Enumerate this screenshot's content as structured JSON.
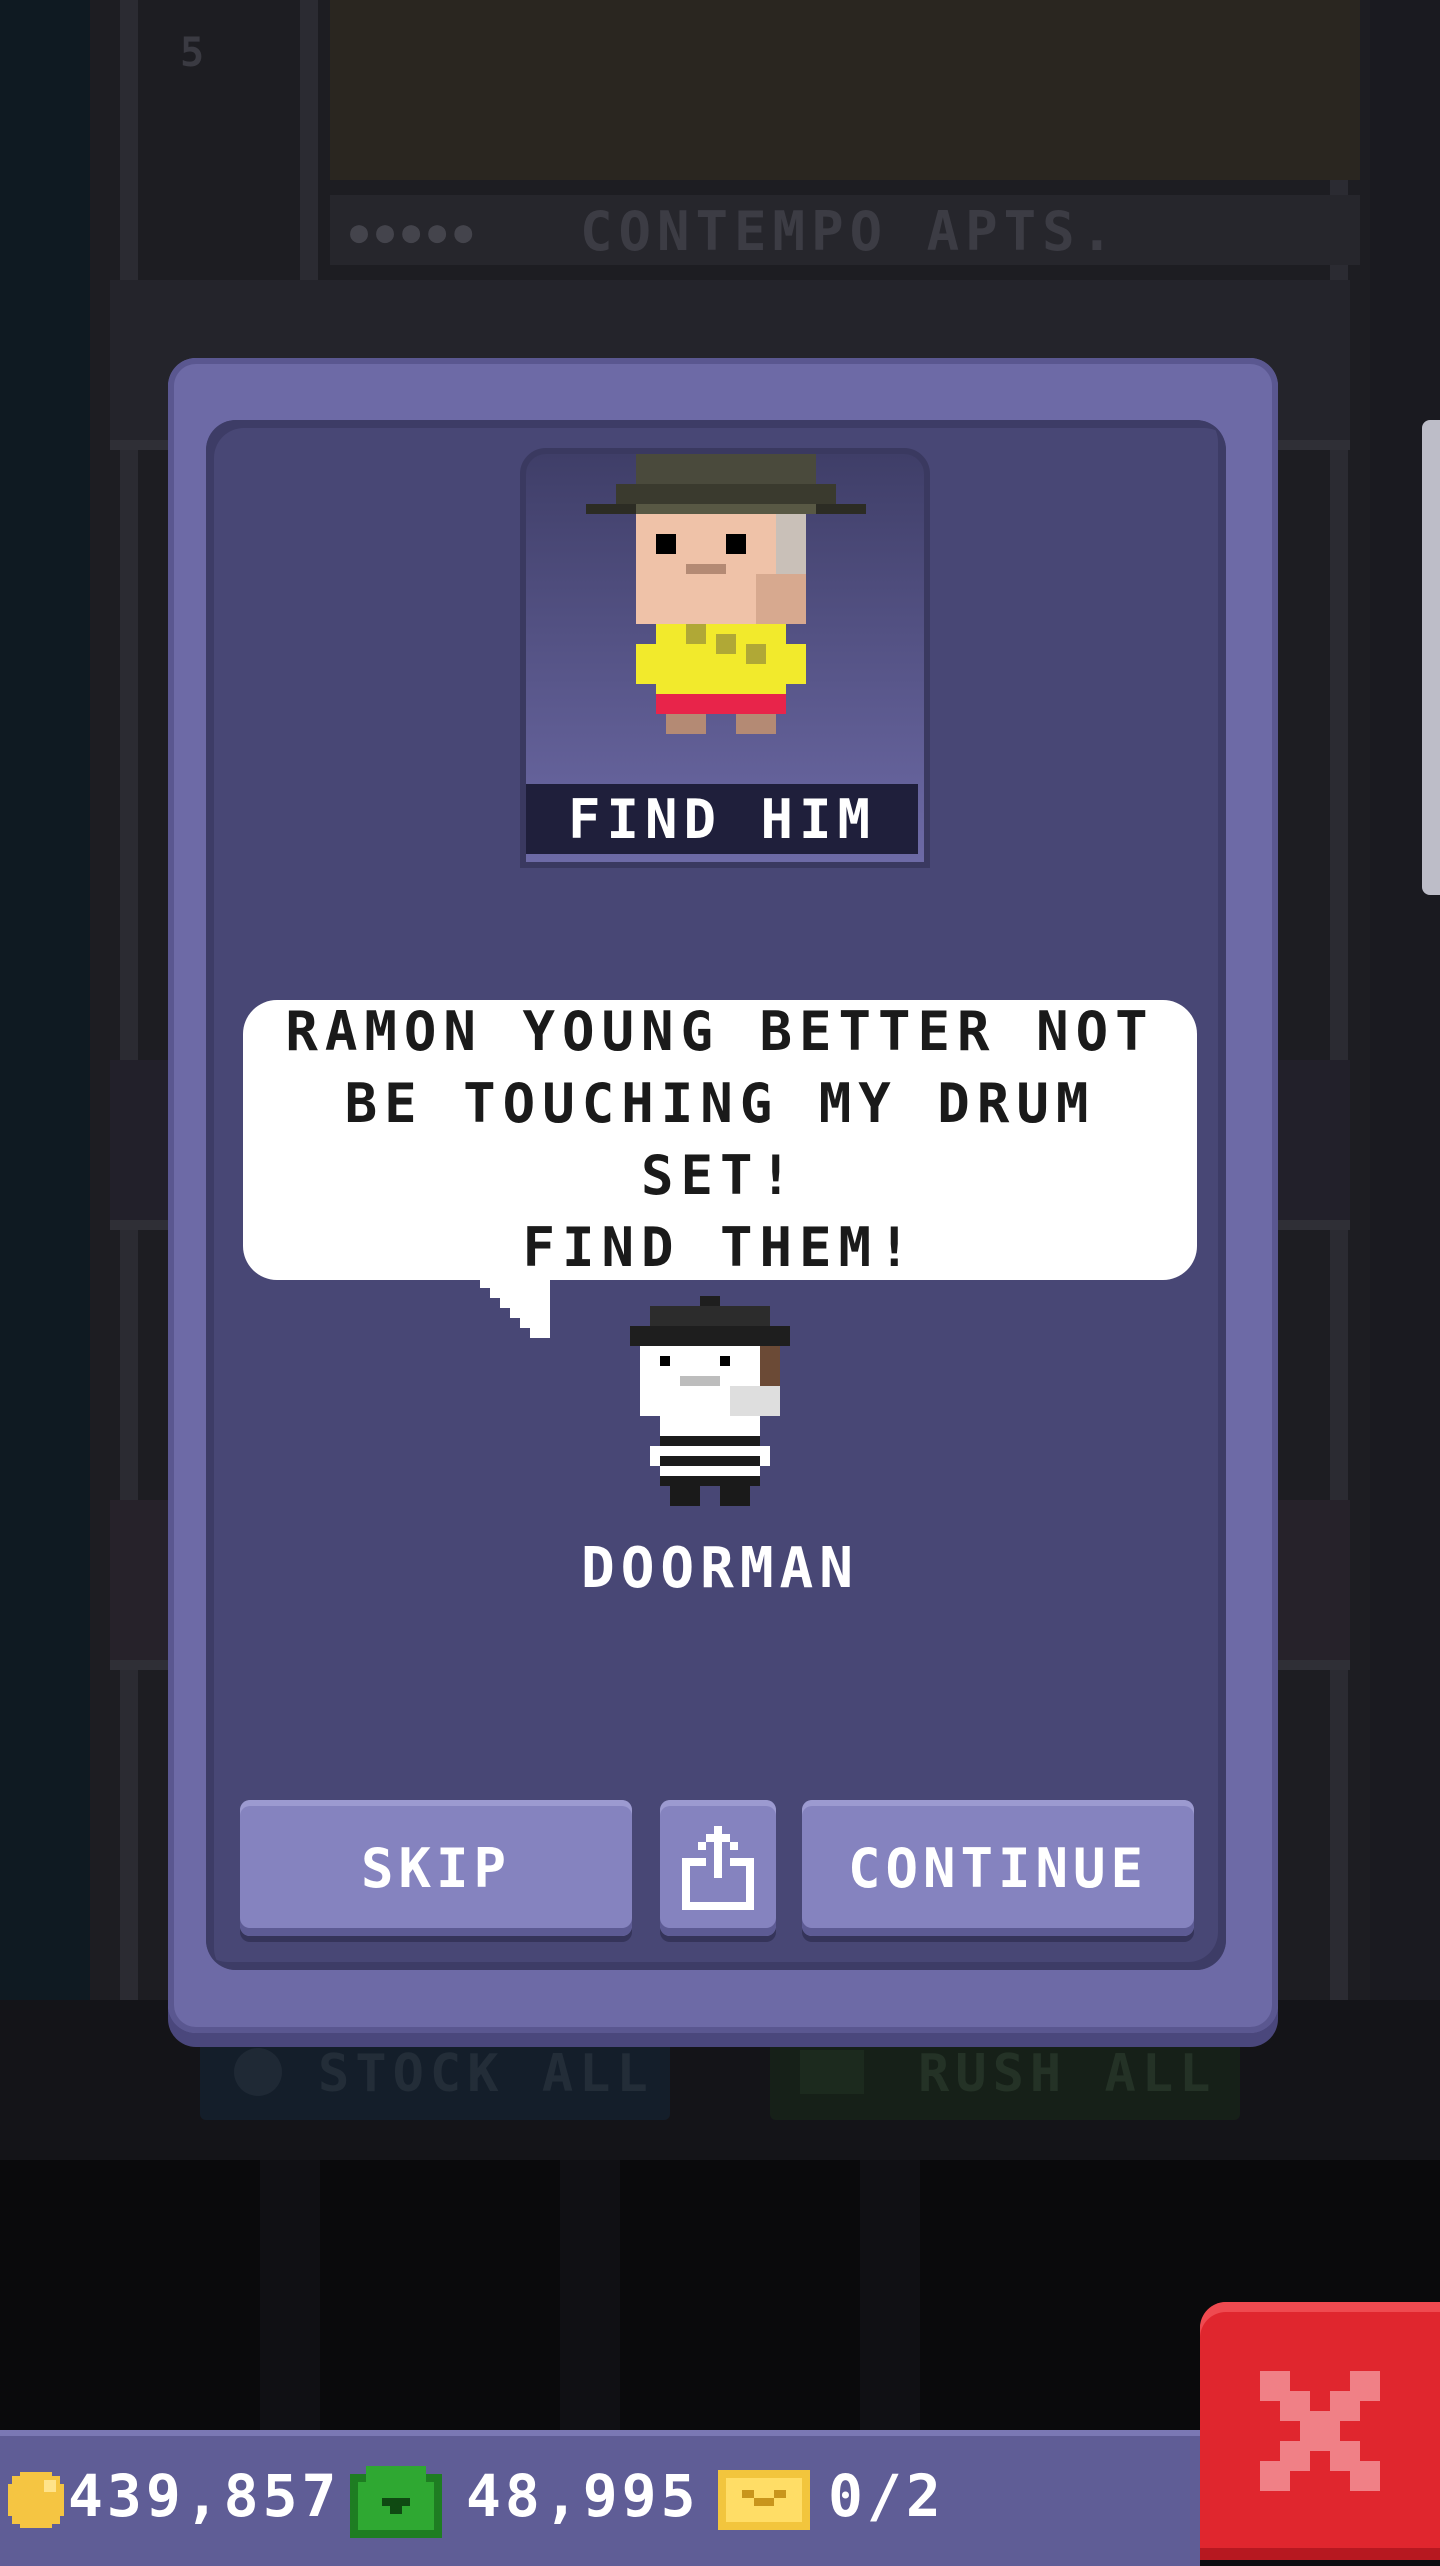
{
  "background": {
    "floor_number": "5",
    "floor_name": "CONTEMPO APTS.",
    "stock_all_label": "STOCK ALL",
    "rush_all_label": "RUSH ALL"
  },
  "dialog": {
    "portrait_caption": "FIND HIM",
    "speech_lines": [
      "RAMON YOUNG BETTER NOT",
      "BE TOUCHING MY DRUM SET!",
      "FIND THEM!"
    ],
    "speaker_name": "DOORMAN",
    "skip_label": "SKIP",
    "continue_label": "CONTINUE"
  },
  "resources": {
    "coins": "439,857",
    "bux": "48,995",
    "tickets": "0/2"
  },
  "colors": {
    "dialog_frame": "#6d6aa6",
    "dialog_inner": "#484775",
    "button": "#8583bf",
    "close_red": "#e0262e",
    "coin_gold": "#f5c542",
    "bux_green": "#2fa832",
    "ticket_gold": "#f2c53d"
  },
  "icons": {
    "share": "share-icon",
    "close": "close-icon",
    "coin": "coin-icon",
    "bux": "bux-icon",
    "ticket": "ticket-icon"
  }
}
